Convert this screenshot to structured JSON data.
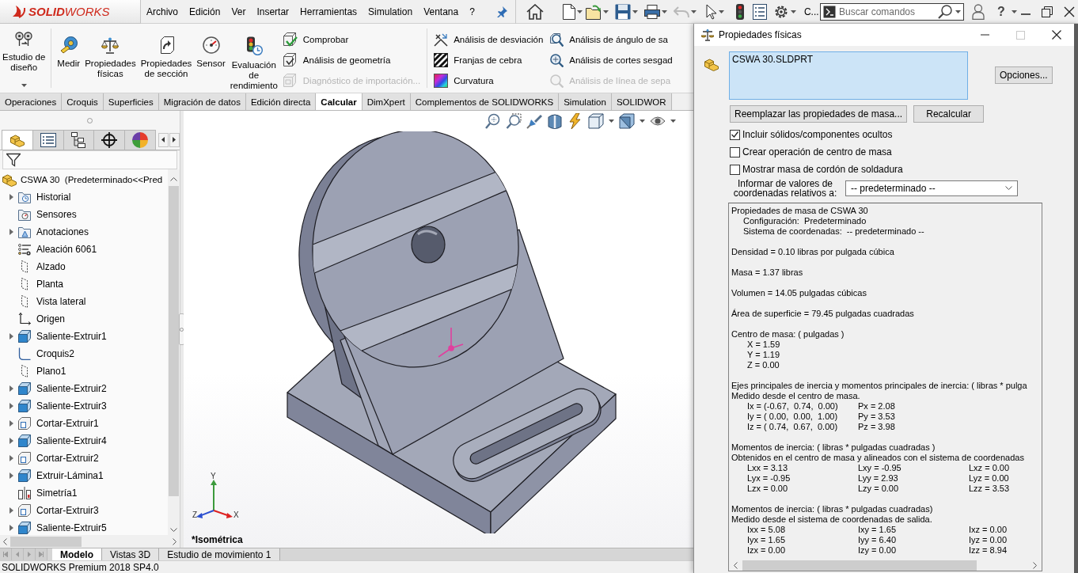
{
  "app": {
    "logo": "**SOLID**WORKS",
    "menu": [
      "Archivo",
      "Edición",
      "Ver",
      "Insertar",
      "Herramientas",
      "Simulation",
      "Ventana",
      "?"
    ],
    "toolbar_more": "C...",
    "search": {
      "placeholder": "Buscar comandos"
    },
    "help": "?"
  },
  "ribbon": {
    "large_tools": [
      {
        "label": "Estudio de\ndiseño",
        "dropdown": true
      },
      {
        "label": "Medir",
        "dropdown": false
      },
      {
        "label": "Propiedades\nfísicas",
        "dropdown": false
      },
      {
        "label": "Propiedades\nde sección",
        "dropdown": false
      },
      {
        "label": "Sensor",
        "dropdown": false
      },
      {
        "label": "Evaluación\nde\nrendimiento",
        "dropdown": false
      }
    ],
    "tool_groups": [
      {
        "tools": [
          {
            "label": "Comprobar",
            "disabled": false
          },
          {
            "label": "Análisis de geometría",
            "disabled": false
          },
          {
            "label": "Diagnóstico de importación...",
            "disabled": true
          }
        ]
      },
      {
        "tools": [
          {
            "label": "Análisis de desviación",
            "disabled": false
          },
          {
            "label": "Franjas de cebra",
            "disabled": false
          },
          {
            "label": "Curvatura",
            "disabled": false
          }
        ]
      },
      {
        "tools": [
          {
            "label": "Análisis de ángulo de sa",
            "disabled": false
          },
          {
            "label": "Análisis de cortes sesgad",
            "disabled": false
          },
          {
            "label": "Análisis de línea de sepa",
            "disabled": true
          }
        ]
      }
    ],
    "tabs": [
      {
        "label": "Operaciones",
        "selected": false
      },
      {
        "label": "Croquis",
        "selected": false
      },
      {
        "label": "Superficies",
        "selected": false
      },
      {
        "label": "Migración de datos",
        "selected": false
      },
      {
        "label": "Edición directa",
        "selected": false
      },
      {
        "label": "Calcular",
        "selected": true
      },
      {
        "label": "DimXpert",
        "selected": false
      },
      {
        "label": "Complementos de SOLIDWORKS",
        "selected": false
      },
      {
        "label": "Simulation",
        "selected": false
      },
      {
        "label": "SOLIDWOR",
        "selected": false
      }
    ]
  },
  "feature_tree": {
    "panel_tabs": [
      {
        "selected": true
      },
      {
        "selected": false
      },
      {
        "selected": false
      },
      {
        "selected": false
      },
      {
        "selected": false
      }
    ],
    "root": "CSWA 30  (Predeterminado<<Pred",
    "items": [
      {
        "label": "Historial",
        "kind": "history",
        "expandable": true
      },
      {
        "label": "Sensores",
        "kind": "sensors",
        "expandable": false
      },
      {
        "label": "Anotaciones",
        "kind": "annotations",
        "expandable": true
      },
      {
        "label": "Aleación 6061",
        "kind": "material",
        "expandable": false
      },
      {
        "label": "Alzado",
        "kind": "plane",
        "expandable": false
      },
      {
        "label": "Planta",
        "kind": "plane",
        "expandable": false
      },
      {
        "label": "Vista lateral",
        "kind": "plane",
        "expandable": false
      },
      {
        "label": "Origen",
        "kind": "origin",
        "expandable": false
      },
      {
        "label": "Saliente-Extruir1",
        "kind": "boss",
        "expandable": true
      },
      {
        "label": "Croquis2",
        "kind": "sketch",
        "expandable": false
      },
      {
        "label": "Plano1",
        "kind": "plane",
        "expandable": false
      },
      {
        "label": "Saliente-Extruir2",
        "kind": "boss",
        "expandable": true
      },
      {
        "label": "Saliente-Extruir3",
        "kind": "boss",
        "expandable": true
      },
      {
        "label": "Cortar-Extruir1",
        "kind": "cut",
        "expandable": true
      },
      {
        "label": "Saliente-Extruir4",
        "kind": "boss",
        "expandable": true
      },
      {
        "label": "Cortar-Extruir2",
        "kind": "cut",
        "expandable": true
      },
      {
        "label": "Extruir-Lámina1",
        "kind": "boss",
        "expandable": true
      },
      {
        "label": "Simetría1",
        "kind": "mirror",
        "expandable": false
      },
      {
        "label": "Cortar-Extruir3",
        "kind": "cut",
        "expandable": true
      },
      {
        "label": "Saliente-Extruir5",
        "kind": "boss",
        "expandable": true
      }
    ]
  },
  "viewport": {
    "triad_axes": [
      "Y",
      "Z",
      "X"
    ],
    "view_name": "*Isométrica"
  },
  "bottom_tabs": [
    {
      "label": "Modelo",
      "selected": true
    },
    {
      "label": "Vistas 3D",
      "selected": false
    },
    {
      "label": "Estudio de movimiento 1",
      "selected": false
    }
  ],
  "status_bar": "SOLIDWORKS Premium 2018 SP4.0",
  "dialog": {
    "title": "Propiedades físicas",
    "selection": "CSWA 30.SLDPRT",
    "options_button": "Opciones...",
    "buttons": [
      "Reemplazar las propiedades de masa...",
      "Recalcular"
    ],
    "checkboxes": [
      {
        "label": "Incluir sólidos/componentes ocultos",
        "checked": true
      },
      {
        "label": "Crear operación de centro de masa",
        "checked": false
      },
      {
        "label": "Mostrar masa de cordón de soldadura",
        "checked": false
      }
    ],
    "coordinates_label": "Informar de valores de\ncoordenadas relativos a:",
    "coordinates_value": "-- predeterminado --",
    "results": [
      {
        "rows": [
          {
            "kind": "text",
            "text": "Propiedades de masa de CSWA 30"
          },
          {
            "kind": "sub",
            "text": "Configuración:  Predeterminado"
          },
          {
            "kind": "sub",
            "text": "Sistema de coordenadas:  -- predeterminado --"
          }
        ]
      },
      {
        "rows": [
          {
            "kind": "text",
            "text": "Densidad = 0.10 libras por pulgada cúbica"
          }
        ]
      },
      {
        "rows": [
          {
            "kind": "text",
            "text": "Masa = 1.37 libras"
          }
        ]
      },
      {
        "rows": [
          {
            "kind": "text",
            "text": "Volumen = 14.05 pulgadas cúbicas"
          }
        ]
      },
      {
        "rows": [
          {
            "kind": "text",
            "text": "Área de superficie = 79.45 pulgadas cuadradas"
          }
        ]
      },
      {
        "rows": [
          {
            "kind": "text",
            "text": "Centro de masa: ( pulgadas )"
          },
          {
            "kind": "value",
            "text": "X = 1.59"
          },
          {
            "kind": "value",
            "text": "Y = 1.19"
          },
          {
            "kind": "value",
            "text": "Z = 0.00"
          }
        ]
      },
      {
        "rows": [
          {
            "kind": "text",
            "text": "Ejes principales de inercia y momentos principales de inercia: ( libras * pulga"
          },
          {
            "kind": "text",
            "text": "Medido desde el centro de masa."
          },
          {
            "kind": "columns",
            "cells": [
              "Ix = (-0.67,  0.74,  0.00)",
              "Px = 2.08"
            ]
          },
          {
            "kind": "columns",
            "cells": [
              "Iy = ( 0.00,  0.00,  1.00)",
              "Py = 3.53"
            ]
          },
          {
            "kind": "columns",
            "cells": [
              "Iz = ( 0.74,  0.67,  0.00)",
              "Pz = 3.98"
            ]
          }
        ]
      },
      {
        "rows": [
          {
            "kind": "text",
            "text": "Momentos de inercia: ( libras * pulgadas cuadradas )"
          },
          {
            "kind": "text",
            "text": "Obtenidos en el centro de masa y alineados con el sistema de coordenadas"
          },
          {
            "kind": "columns",
            "cells": [
              "Lxx = 3.13",
              "Lxy = -0.95",
              "Lxz = 0.00"
            ]
          },
          {
            "kind": "columns",
            "cells": [
              "Lyx = -0.95",
              "Lyy = 2.93",
              "Lyz = 0.00"
            ]
          },
          {
            "kind": "columns",
            "cells": [
              "Lzx = 0.00",
              "Lzy = 0.00",
              "Lzz = 3.53"
            ]
          }
        ]
      },
      {
        "rows": [
          {
            "kind": "text",
            "text": "Momentos de inercia: ( libras * pulgadas cuadradas)"
          },
          {
            "kind": "text",
            "text": "Medido desde el sistema de coordenadas de salida."
          },
          {
            "kind": "columns",
            "cells": [
              "Ixx = 5.08",
              "Ixy = 1.65",
              "Ixz = 0.00"
            ]
          },
          {
            "kind": "columns",
            "cells": [
              "Iyx = 1.65",
              "Iyy = 6.40",
              "Iyz = 0.00"
            ]
          },
          {
            "kind": "columns",
            "cells": [
              "Izx = 0.00",
              "Izy = 0.00",
              "Izz = 8.94"
            ]
          }
        ]
      }
    ]
  }
}
